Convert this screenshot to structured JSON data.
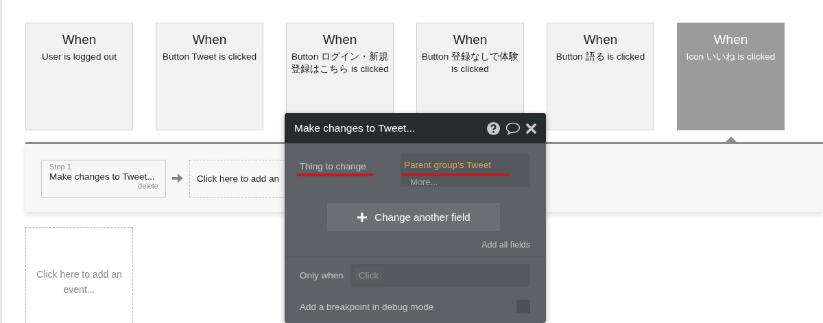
{
  "events": [
    {
      "heading": "When",
      "description": "User is logged out",
      "selected": false
    },
    {
      "heading": "When",
      "description": "Button Tweet is clicked",
      "selected": false
    },
    {
      "heading": "When",
      "description": "Button ログイン・新規登録はこちら is clicked",
      "selected": false
    },
    {
      "heading": "When",
      "description": "Button 登録なしで体験 is clicked",
      "selected": false
    },
    {
      "heading": "When",
      "description": "Button 語る is clicked",
      "selected": false
    },
    {
      "heading": "When",
      "description": "Icon いいね is clicked",
      "selected": true
    }
  ],
  "workflow": {
    "steps": [
      {
        "label": "Step 1",
        "title": "Make changes to Tweet...",
        "delete": "delete"
      }
    ],
    "add_action": "Click here to add an"
  },
  "add_event": "Click here to add an event...",
  "dialog": {
    "title": "Make changes to Tweet...",
    "fields": [
      {
        "label": "Thing to change",
        "value": "Parent group's Tweet",
        "more": "More..."
      }
    ],
    "change_button": "Change another field",
    "add_all": "Add all fields",
    "only_when": {
      "label": "Only when",
      "value": "Click"
    },
    "breakpoint": {
      "label": "Add a breakpoint in debug mode",
      "checked": false
    }
  }
}
